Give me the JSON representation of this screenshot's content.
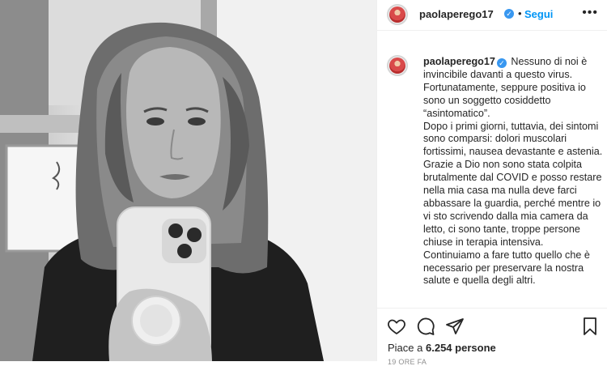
{
  "post": {
    "username": "paolaperego17",
    "verified": true,
    "follow_label": "Segui",
    "more_label": "•••",
    "photo_alt": "Foto in bianco e nero di una donna che si fa un selfie allo specchio",
    "caption": {
      "username": "paolaperego17",
      "text": "Nessuno di noi è invincibile davanti a questo virus.\nFortunatamente, seppure positiva io sono un soggetto cosiddetto “asintomatico”.\nDopo i primi giorni, tuttavia, dei sintomi sono comparsi: dolori muscolari fortissimi, nausea devastante e astenia.\nGrazie a Dio non sono stata colpita brutalmente dal COVID e posso restare nella mia casa ma nulla deve farci abbassare la guardia, perché mentre io vi sto scrivendo dalla mia camera da letto, ci sono tante, troppe persone chiuse in terapia intensiva.\nContinuiamo a fare tutto quello che è necessario per preservare la nostra salute e quella degli altri."
    },
    "likes_prefix": "Piace a",
    "likes_count": "6.254",
    "likes_suffix": "persone",
    "date": "19 ORE FA"
  },
  "icons": {
    "like": "heart-icon",
    "comment": "comment-icon",
    "share": "share-icon",
    "save": "bookmark-icon",
    "verified": "verified-badge-icon"
  },
  "colors": {
    "link": "#0095f6",
    "verified": "#3897f0",
    "text": "#262626",
    "secondary": "#8e8e8e",
    "border": "#efefef"
  }
}
